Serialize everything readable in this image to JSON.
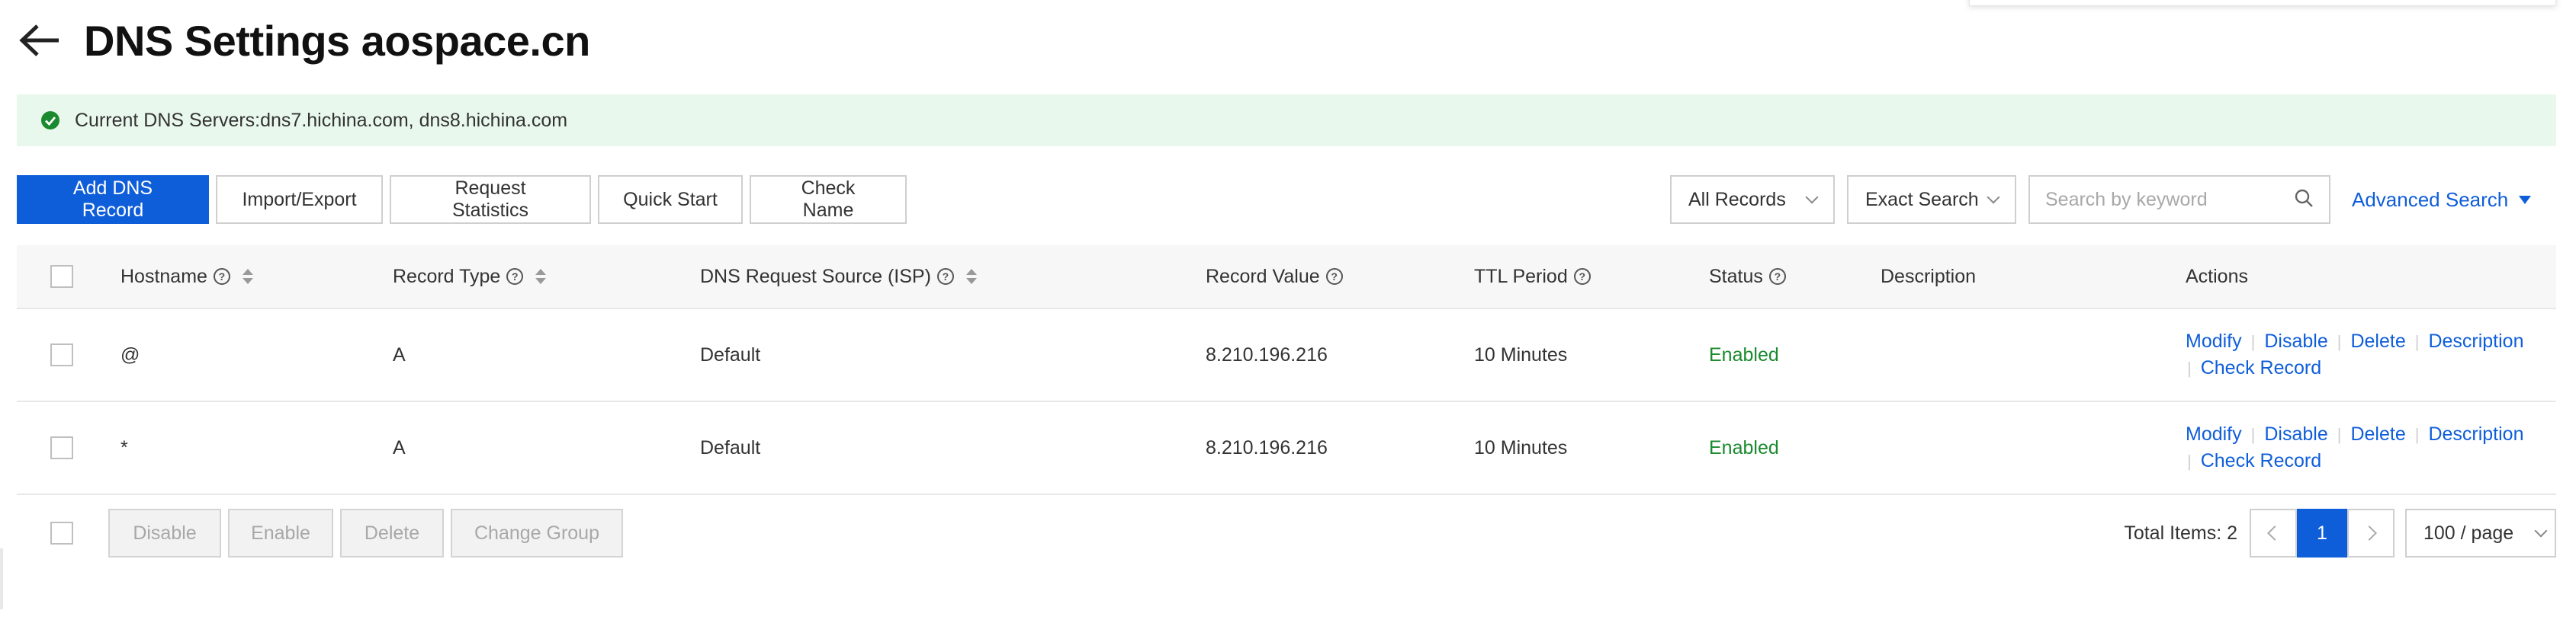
{
  "header": {
    "title": "DNS Settings aospace.cn",
    "back_icon": "arrow-left-icon"
  },
  "banner": {
    "text": "Current DNS Servers:dns7.hichina.com, dns8.hichina.com",
    "icon": "check-circle-icon",
    "color": "#1a8a2e"
  },
  "toolbar": {
    "add_label": "Add DNS Record",
    "import_label": "Import/Export",
    "stats_label": "Request Statistics",
    "quick_label": "Quick Start",
    "check_label": "Check Name",
    "record_filter": "All Records",
    "search_mode": "Exact Search",
    "search_placeholder": "Search by keyword",
    "advanced_label": "Advanced Search"
  },
  "table": {
    "columns": {
      "hostname": "Hostname",
      "record_type": "Record Type",
      "isp": "DNS Request Source (ISP)",
      "value": "Record Value",
      "ttl": "TTL Period",
      "status": "Status",
      "description": "Description",
      "actions": "Actions"
    },
    "rows": [
      {
        "hostname": "@",
        "type": "A",
        "isp": "Default",
        "value": "8.210.196.216",
        "ttl": "10 Minutes",
        "status": "Enabled",
        "description": ""
      },
      {
        "hostname": "*",
        "type": "A",
        "isp": "Default",
        "value": "8.210.196.216",
        "ttl": "10 Minutes",
        "status": "Enabled",
        "description": ""
      }
    ],
    "actions": {
      "modify": "Modify",
      "disable": "Disable",
      "delete": "Delete",
      "description": "Description",
      "check_record": "Check Record"
    }
  },
  "footer": {
    "disable_label": "Disable",
    "enable_label": "Enable",
    "delete_label": "Delete",
    "change_group_label": "Change Group",
    "total": "Total Items: 2",
    "current_page": "1",
    "page_size": "100 / page"
  },
  "colors": {
    "primary": "#0f5ed9",
    "enabled": "#1a8a2e",
    "banner_bg": "#e9f8ec"
  }
}
